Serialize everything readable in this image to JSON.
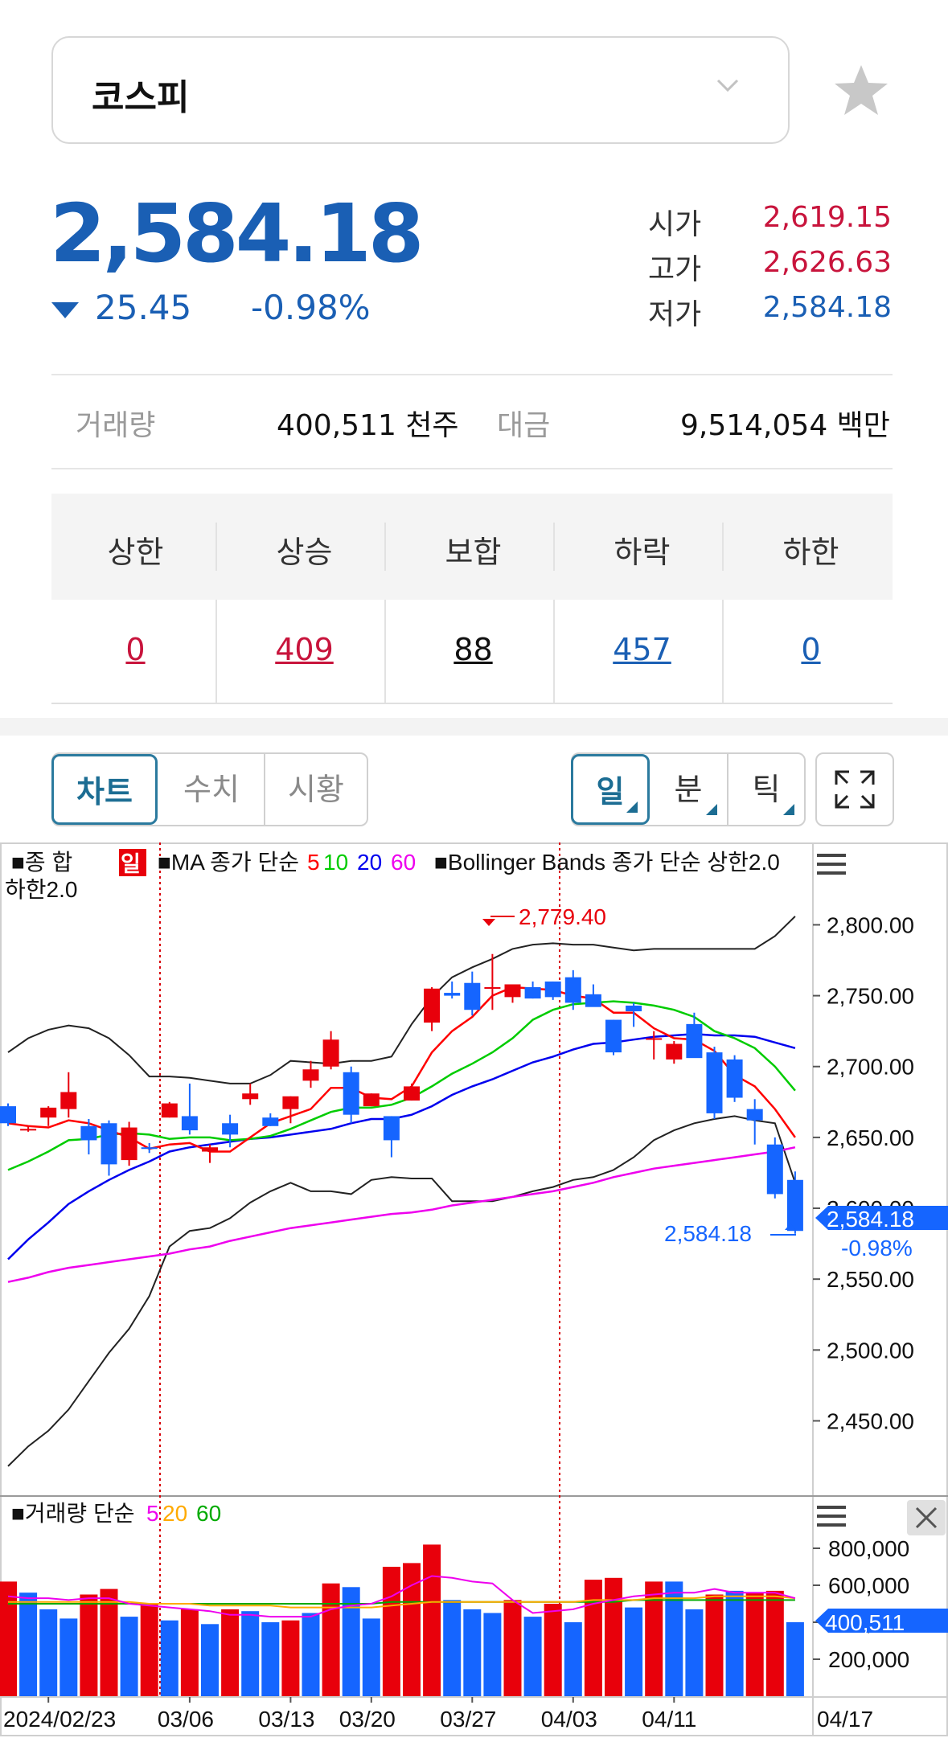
{
  "selector": {
    "label": "코스피"
  },
  "quote": {
    "price": "2,584.18",
    "change": "25.45",
    "change_pct": "-0.98%",
    "open_label": "시가",
    "open": "2,619.15",
    "high_label": "고가",
    "high": "2,626.63",
    "low_label": "저가",
    "low": "2,584.18"
  },
  "volume": {
    "volume_label": "거래량",
    "volume_value": "400,511 천주",
    "amount_label": "대금",
    "amount_value": "9,514,054 백만"
  },
  "breadth": [
    {
      "label": "상한",
      "value": "0",
      "color": "#c8143c"
    },
    {
      "label": "상승",
      "value": "409",
      "color": "#c8143c"
    },
    {
      "label": "보합",
      "value": "88",
      "color": "#111111"
    },
    {
      "label": "하락",
      "value": "457",
      "color": "#1a5fb4"
    },
    {
      "label": "하한",
      "value": "0",
      "color": "#1a5fb4"
    }
  ],
  "view_tabs": [
    "차트",
    "수치",
    "시황"
  ],
  "period_tabs": [
    "일",
    "분",
    "틱"
  ],
  "icons": {
    "dropdown": "chevron-down-icon",
    "favorite": "star-icon",
    "expand": "expand-icon",
    "menu": "hamburger-icon",
    "close": "close-icon",
    "down": "triangle-down-icon"
  },
  "colors": {
    "up": "#e8000b",
    "down": "#1565ff",
    "accent": "#1a5fb4",
    "ma5": "#ff0000",
    "ma10": "#00cc00",
    "ma20": "#0000ee",
    "ma60": "#ee00ee"
  },
  "chart_data": [
    {
      "type": "candlestick",
      "legend": {
        "prefix": "■종     합",
        "period_badge": "일",
        "ma": "■MA 종가 단순",
        "ma_periods": [
          "5",
          "10",
          "20",
          "60"
        ],
        "bb": "■Bollinger Bands 종가 단순 상한2.0",
        "bb2": "하한2.0"
      },
      "x_labels": [
        "2024/02/23",
        "03/06",
        "03/13",
        "03/20",
        "03/27",
        "04/03",
        "04/11",
        "04/17"
      ],
      "y_ticks": [
        "2,800.00",
        "2,750.00",
        "2,700.00",
        "2,650.00",
        "2,600.00",
        "2,550.00",
        "2,500.00",
        "2,450.00"
      ],
      "ylim": [
        2410,
        2815
      ],
      "high_marker": "2,779.40",
      "low_marker": "2,584.18",
      "last_value": "2,584.18",
      "last_pct": "-0.98%",
      "candles": [
        [
          2672,
          2674,
          2658,
          2660
        ],
        [
          2656,
          2658,
          2654,
          2656
        ],
        [
          2664,
          2672,
          2658,
          2671
        ],
        [
          2670,
          2696,
          2664,
          2682
        ],
        [
          2658,
          2663,
          2638,
          2648
        ],
        [
          2660,
          2662,
          2623,
          2631
        ],
        [
          2634,
          2661,
          2630,
          2657
        ],
        [
          2643,
          2646,
          2639,
          2642
        ],
        [
          2664,
          2675,
          2664,
          2674
        ],
        [
          2665,
          2688,
          2652,
          2655
        ],
        [
          2640,
          2645,
          2632,
          2643
        ],
        [
          2660,
          2666,
          2643,
          2652
        ],
        [
          2677,
          2688,
          2673,
          2681
        ],
        [
          2664,
          2667,
          2658,
          2658
        ],
        [
          2670,
          2679,
          2660,
          2679
        ],
        [
          2690,
          2704,
          2685,
          2698
        ],
        [
          2700,
          2725,
          2698,
          2719
        ],
        [
          2696,
          2700,
          2660,
          2666
        ],
        [
          2672,
          2681,
          2672,
          2681
        ],
        [
          2665,
          2665,
          2636,
          2648
        ],
        [
          2676,
          2688,
          2676,
          2686
        ],
        [
          2731,
          2756,
          2725,
          2755
        ],
        [
          2752,
          2760,
          2748,
          2750
        ],
        [
          2759,
          2767,
          2736,
          2740
        ],
        [
          2755,
          2779.4,
          2740,
          2756
        ],
        [
          2749,
          2758,
          2745,
          2758
        ],
        [
          2756,
          2760,
          2748,
          2748
        ],
        [
          2760,
          2760,
          2747,
          2749
        ],
        [
          2763,
          2768,
          2740,
          2745
        ],
        [
          2751,
          2758,
          2743,
          2742
        ],
        [
          2733,
          2733,
          2708,
          2710
        ],
        [
          2743,
          2745,
          2728,
          2739
        ],
        [
          2720,
          2725,
          2705,
          2720
        ],
        [
          2705,
          2718,
          2702,
          2716
        ],
        [
          2730,
          2738,
          2708,
          2706
        ],
        [
          2710,
          2714,
          2663,
          2667
        ],
        [
          2705,
          2708,
          2675,
          2678
        ],
        [
          2670,
          2677,
          2645,
          2662
        ],
        [
          2645,
          2650,
          2607,
          2610
        ],
        [
          2620,
          2626,
          2582,
          2584
        ]
      ],
      "ma5": [
        2660,
        2658,
        2657,
        2662,
        2660,
        2655,
        2650,
        2642,
        2645,
        2646,
        2640,
        2640,
        2650,
        2660,
        2665,
        2670,
        2685,
        2685,
        2678,
        2677,
        2686,
        2710,
        2725,
        2735,
        2750,
        2756,
        2755,
        2754,
        2750,
        2748,
        2738,
        2738,
        2727,
        2720,
        2719,
        2711,
        2694,
        2686,
        2670,
        2650
      ],
      "ma10": [
        2627,
        2633,
        2640,
        2648,
        2649,
        2652,
        2653,
        2652,
        2649,
        2650,
        2650,
        2648,
        2649,
        2651,
        2656,
        2662,
        2668,
        2671,
        2671,
        2673,
        2678,
        2686,
        2695,
        2702,
        2710,
        2720,
        2733,
        2740,
        2744,
        2745,
        2746,
        2745,
        2743,
        2740,
        2735,
        2725,
        2720,
        2713,
        2700,
        2683
      ],
      "ma20": [
        2564,
        2578,
        2590,
        2603,
        2612,
        2620,
        2627,
        2633,
        2640,
        2643,
        2645,
        2647,
        2649,
        2650,
        2652,
        2654,
        2656,
        2660,
        2663,
        2663,
        2666,
        2672,
        2680,
        2686,
        2691,
        2697,
        2703,
        2707,
        2712,
        2716,
        2717,
        2719,
        2721,
        2722,
        2723,
        2722,
        2722,
        2721,
        2717,
        2713
      ],
      "ma60": [
        2548,
        2551,
        2555,
        2558,
        2560,
        2562,
        2564,
        2566,
        2568,
        2571,
        2573,
        2577,
        2580,
        2583,
        2586,
        2588,
        2590,
        2592,
        2594,
        2596,
        2597,
        2599,
        2602,
        2604,
        2606,
        2608,
        2610,
        2612,
        2615,
        2618,
        2622,
        2625,
        2628,
        2630,
        2632,
        2634,
        2636,
        2638,
        2640,
        2643
      ],
      "bb_upper": [
        2710,
        2720,
        2726,
        2729,
        2727,
        2720,
        2708,
        2693,
        2693,
        2692,
        2690,
        2688,
        2688,
        2694,
        2704,
        2703,
        2702,
        2704,
        2704,
        2707,
        2730,
        2749,
        2763,
        2770,
        2776,
        2783,
        2786,
        2787,
        2786,
        2786,
        2784,
        2782,
        2783,
        2783,
        2783,
        2783,
        2783,
        2783,
        2792,
        2806
      ],
      "bb_lower": [
        2418,
        2432,
        2443,
        2458,
        2478,
        2498,
        2515,
        2538,
        2573,
        2584,
        2586,
        2593,
        2604,
        2612,
        2618,
        2612,
        2612,
        2610,
        2620,
        2622,
        2621,
        2621,
        2605,
        2605,
        2605,
        2608,
        2612,
        2615,
        2620,
        2622,
        2627,
        2636,
        2648,
        2655,
        2660,
        2663,
        2665,
        2662,
        2660,
        2618
      ]
    },
    {
      "type": "bar",
      "legend": {
        "title": "■거래량 단순",
        "ma_periods": [
          "5",
          "20",
          "60"
        ]
      },
      "y_ticks": [
        "800,000",
        "600,000",
        "400,000",
        "200,000"
      ],
      "ylim": [
        0,
        900000
      ],
      "last_value": "400,511",
      "bars": [
        [
          620000,
          "up"
        ],
        [
          560000,
          "down"
        ],
        [
          470000,
          "down"
        ],
        [
          420000,
          "down"
        ],
        [
          550000,
          "up"
        ],
        [
          580000,
          "up"
        ],
        [
          430000,
          "down"
        ],
        [
          500000,
          "up"
        ],
        [
          410000,
          "down"
        ],
        [
          470000,
          "up"
        ],
        [
          390000,
          "down"
        ],
        [
          470000,
          "up"
        ],
        [
          460000,
          "down"
        ],
        [
          400000,
          "down"
        ],
        [
          410000,
          "up"
        ],
        [
          450000,
          "down"
        ],
        [
          610000,
          "up"
        ],
        [
          590000,
          "down"
        ],
        [
          420000,
          "down"
        ],
        [
          700000,
          "up"
        ],
        [
          720000,
          "up"
        ],
        [
          820000,
          "up"
        ],
        [
          520000,
          "down"
        ],
        [
          470000,
          "down"
        ],
        [
          450000,
          "down"
        ],
        [
          520000,
          "up"
        ],
        [
          430000,
          "down"
        ],
        [
          500000,
          "up"
        ],
        [
          400000,
          "down"
        ],
        [
          630000,
          "up"
        ],
        [
          640000,
          "up"
        ],
        [
          480000,
          "down"
        ],
        [
          620000,
          "up"
        ],
        [
          620000,
          "down"
        ],
        [
          470000,
          "down"
        ],
        [
          550000,
          "up"
        ],
        [
          570000,
          "down"
        ],
        [
          560000,
          "up"
        ],
        [
          570000,
          "up"
        ],
        [
          400511,
          "down"
        ]
      ],
      "ma5": [
        540000,
        530000,
        530000,
        520000,
        530000,
        530000,
        500000,
        490000,
        480000,
        470000,
        460000,
        440000,
        440000,
        430000,
        430000,
        430000,
        470000,
        490000,
        500000,
        540000,
        600000,
        650000,
        640000,
        620000,
        610000,
        520000,
        450000,
        460000,
        470000,
        500000,
        520000,
        540000,
        550000,
        560000,
        560000,
        580000,
        560000,
        560000,
        560000,
        530000
      ],
      "ma20": [
        510000,
        510000,
        510000,
        510000,
        510000,
        510000,
        510000,
        500000,
        500000,
        500000,
        490000,
        490000,
        490000,
        490000,
        480000,
        480000,
        480000,
        480000,
        480000,
        490000,
        500000,
        510000,
        510000,
        510000,
        510000,
        510000,
        510000,
        510000,
        510000,
        520000,
        520000,
        520000,
        530000,
        530000,
        530000,
        540000,
        540000,
        540000,
        540000,
        530000
      ],
      "ma60": [
        500000,
        500000,
        500000,
        500000,
        500000,
        500000,
        500000,
        500000,
        500000,
        500000,
        500000,
        500000,
        500000,
        500000,
        500000,
        500000,
        500000,
        500000,
        500000,
        510000,
        510000,
        510000,
        510000,
        510000,
        510000,
        510000,
        510000,
        510000,
        510000,
        510000,
        510000,
        520000,
        520000,
        520000,
        520000,
        520000,
        520000,
        520000,
        520000,
        520000
      ]
    }
  ]
}
